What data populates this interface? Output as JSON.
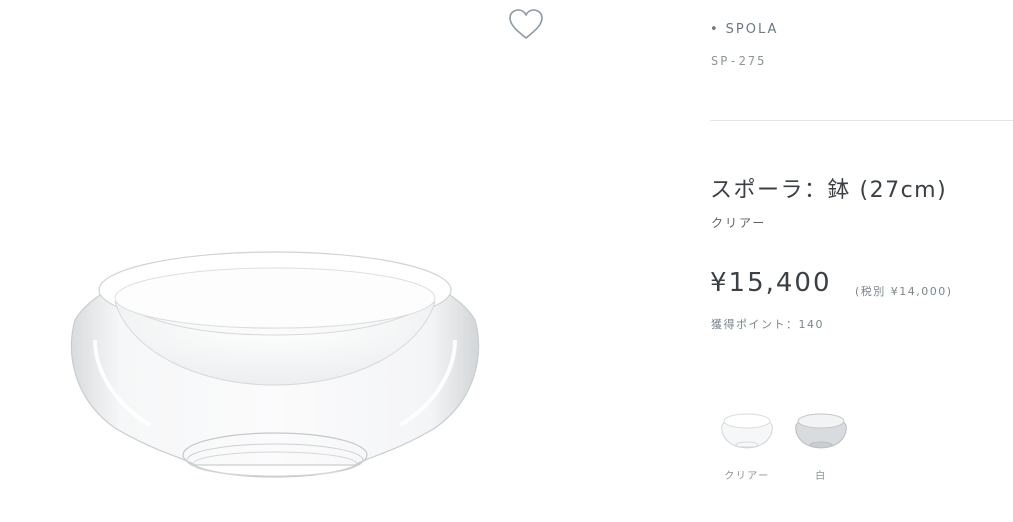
{
  "product": {
    "brand": "SPOLA",
    "brand_bullet": "•",
    "sku": "SP-275",
    "title": "スポーラ：鉢 (27cm)",
    "color_name": "クリアー",
    "price": "¥15,400",
    "price_tax_note": "(税別 ¥14,000)",
    "points": "獲得ポイント：140"
  },
  "favorite": {
    "icon": "heart-outline-icon"
  },
  "variants": [
    {
      "label": "クリアー",
      "swatch": "clear-bowl"
    },
    {
      "label": "白",
      "swatch": "white-bowl"
    }
  ],
  "colors": {
    "text_primary": "#3a4044",
    "text_muted": "#7a858a",
    "brand_text": "#6a7a80",
    "divider": "#e3e6e8"
  }
}
